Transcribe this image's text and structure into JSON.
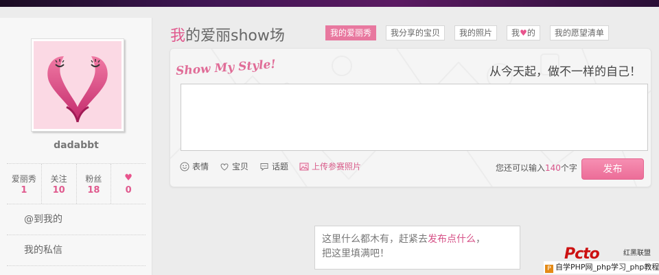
{
  "sidebar": {
    "username": "dadabbt",
    "stats": [
      {
        "label": "爱丽秀",
        "value": "1"
      },
      {
        "label": "关注",
        "value": "10"
      },
      {
        "label": "粉丝",
        "value": "18"
      },
      {
        "icon": "heart-icon",
        "value": "0"
      }
    ],
    "links": [
      "@到我的",
      "我的私信"
    ]
  },
  "header": {
    "title_highlight": "我",
    "title_rest": "的爱丽show场",
    "tabs": [
      {
        "label": "我的爱丽秀",
        "active": true
      },
      {
        "label": "我分享的宝贝",
        "active": false
      },
      {
        "label_pre": "我",
        "label_post": "的",
        "icon": "heart-icon",
        "active": false
      },
      {
        "label": "我的照片",
        "active": false
      },
      {
        "label": "我的愿望清单",
        "active": false
      }
    ]
  },
  "composer": {
    "slogan_left": "Show My Style!",
    "slogan_right": "从今天起，做不一样的自己！",
    "textarea_value": "",
    "tools": [
      {
        "icon": "smiley-icon",
        "label": "表情"
      },
      {
        "icon": "heart-outline-icon",
        "label": "宝贝"
      },
      {
        "icon": "speech-bubble-icon",
        "label": "话题"
      },
      {
        "icon": "image-icon",
        "label": "上传参赛照片"
      }
    ],
    "counter_pre": "您还可以输入",
    "counter_num": "140",
    "counter_post": "个字",
    "publish_label": "发布"
  },
  "empty_state": {
    "line1_pre": "这里什么都木有，赶紧去",
    "line1_link": "发布点什么",
    "line1_post": "，",
    "line2": "把这里填满吧！"
  },
  "watermark": {
    "logo": "Pcto",
    "side": "红黑联盟",
    "bottom": "自学PHP网_php学习_php教程"
  },
  "colors": {
    "accent_pink": "#e8789f",
    "text_pink": "#d65187",
    "top_bar": "#3e1552"
  }
}
